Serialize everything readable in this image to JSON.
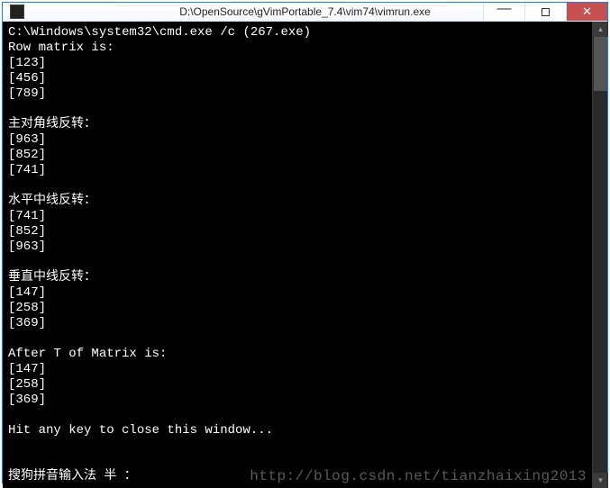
{
  "window": {
    "title": "D:\\OpenSource\\gVimPortable_7.4\\vim74\\vimrun.exe"
  },
  "console": {
    "cmd_line": "C:\\Windows\\system32\\cmd.exe /c (267.exe)",
    "section_row_header": "Row matrix is:",
    "row": [
      "[123]",
      "[456]",
      "[789]"
    ],
    "section_main_diag": "主对角线反转：",
    "main_diag": [
      "[963]",
      "[852]",
      "[741]"
    ],
    "section_horiz": "水平中线反转：",
    "horiz": [
      "[741]",
      "[852]",
      "[963]"
    ],
    "section_vert": "垂直中线反转：",
    "vert": [
      "[147]",
      "[258]",
      "[369]"
    ],
    "section_transpose": "After T of Matrix is:",
    "transpose": [
      "[147]",
      "[258]",
      "[369]"
    ],
    "hit_any_key": "Hit any key to close this window...",
    "ime_status": "搜狗拼音输入法 半 ："
  },
  "watermark": "http://blog.csdn.net/tianzhaixing2013"
}
